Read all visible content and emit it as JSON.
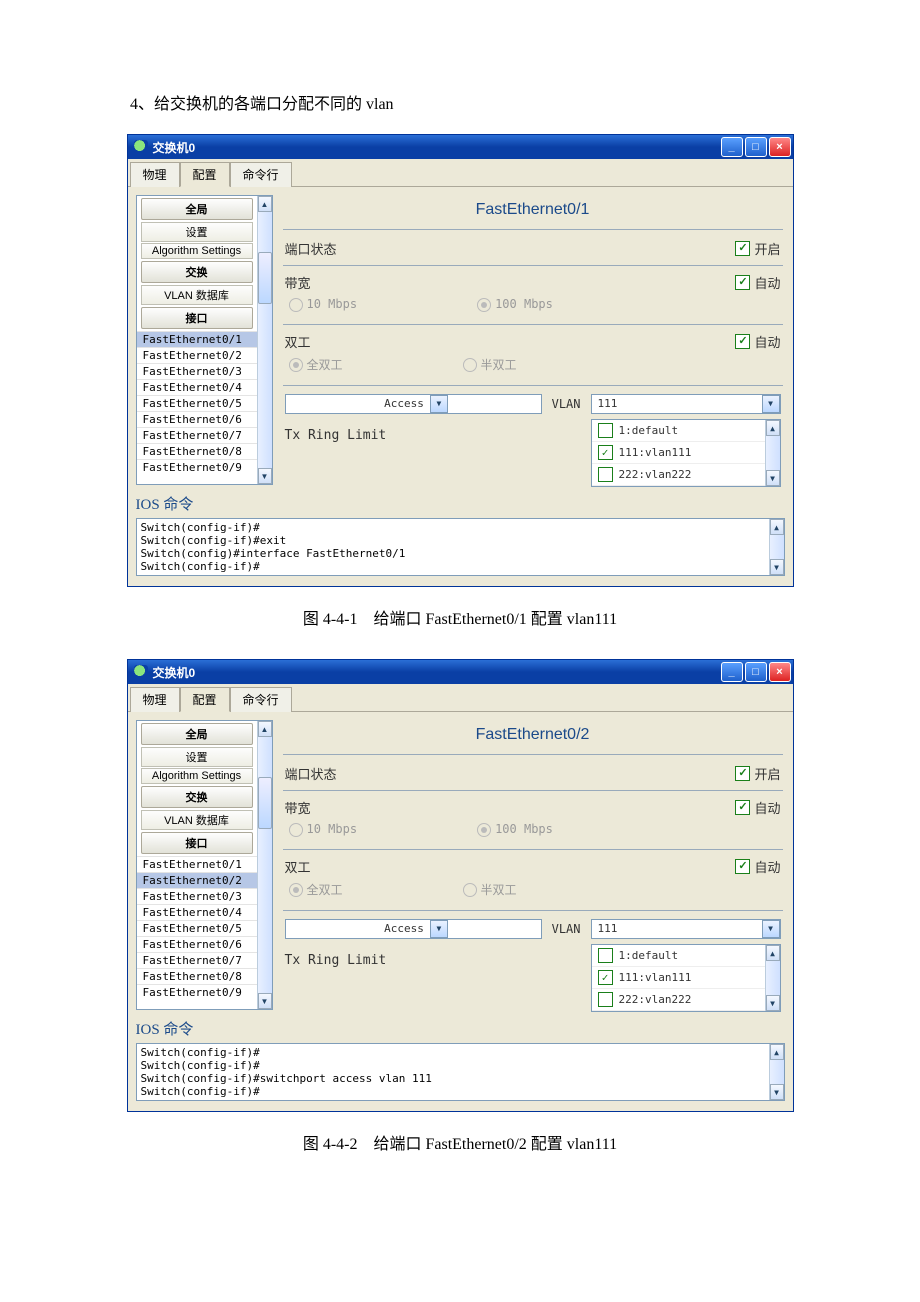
{
  "heading": "4、给交换机的各端口分配不同的 vlan",
  "caption1": "图 4-4-1　给端口 FastEthernet0/1 配置 vlan111",
  "caption2": "图 4-4-2　给端口 FastEthernet0/2 配置 vlan111",
  "window_title": "交换机0",
  "tabs": {
    "t0": "物理",
    "t1": "配置",
    "t2": "命令行"
  },
  "sidebar": {
    "cat0": "全局",
    "cat1": "设置",
    "cat2": "Algorithm Settings",
    "cat3": "交换",
    "cat4": "VLAN 数据库",
    "cat5": "接口",
    "ports": {
      "p1": "FastEthernet0/1",
      "p2": "FastEthernet0/2",
      "p3": "FastEthernet0/3",
      "p4": "FastEthernet0/4",
      "p5": "FastEthernet0/5",
      "p6": "FastEthernet0/6",
      "p7": "FastEthernet0/7",
      "p8": "FastEthernet0/8",
      "p9": "FastEthernet0/9"
    }
  },
  "panel1": {
    "title": "FastEthernet0/1",
    "port_status_label": "端口状态",
    "port_status_chk": "开启",
    "bandwidth_label": "带宽",
    "bandwidth_chk": "自动",
    "bw_10": "10 Mbps",
    "bw_100": "100 Mbps",
    "duplex_label": "双工",
    "duplex_chk": "自动",
    "full": "全双工",
    "half": "半双工",
    "mode": "Access",
    "vlan_label": "VLAN",
    "vlan_value": "111",
    "txring": "Tx Ring Limit",
    "vlan_options": {
      "o1": "1:default",
      "o2": "111:vlan111",
      "o3": "222:vlan222"
    }
  },
  "panel2": {
    "title": "FastEthernet0/2",
    "port_status_label": "端口状态",
    "port_status_chk": "开启",
    "bandwidth_label": "带宽",
    "bandwidth_chk": "自动",
    "bw_10": "10 Mbps",
    "bw_100": "100 Mbps",
    "duplex_label": "双工",
    "duplex_chk": "自动",
    "full": "全双工",
    "half": "半双工",
    "mode": "Access",
    "vlan_label": "VLAN",
    "vlan_value": "111",
    "txring": "Tx Ring Limit",
    "vlan_options": {
      "o1": "1:default",
      "o2": "111:vlan111",
      "o3": "222:vlan222"
    }
  },
  "ios": {
    "title": "IOS 命令",
    "win1": {
      "l1": "Switch(config-if)#",
      "l2": "Switch(config-if)#exit",
      "l3": "Switch(config)#interface FastEthernet0/1",
      "l4": "Switch(config-if)#"
    },
    "win2": {
      "l1": "Switch(config-if)#",
      "l2": "Switch(config-if)#",
      "l3": "Switch(config-if)#switchport access vlan 111",
      "l4": "Switch(config-if)#"
    }
  }
}
